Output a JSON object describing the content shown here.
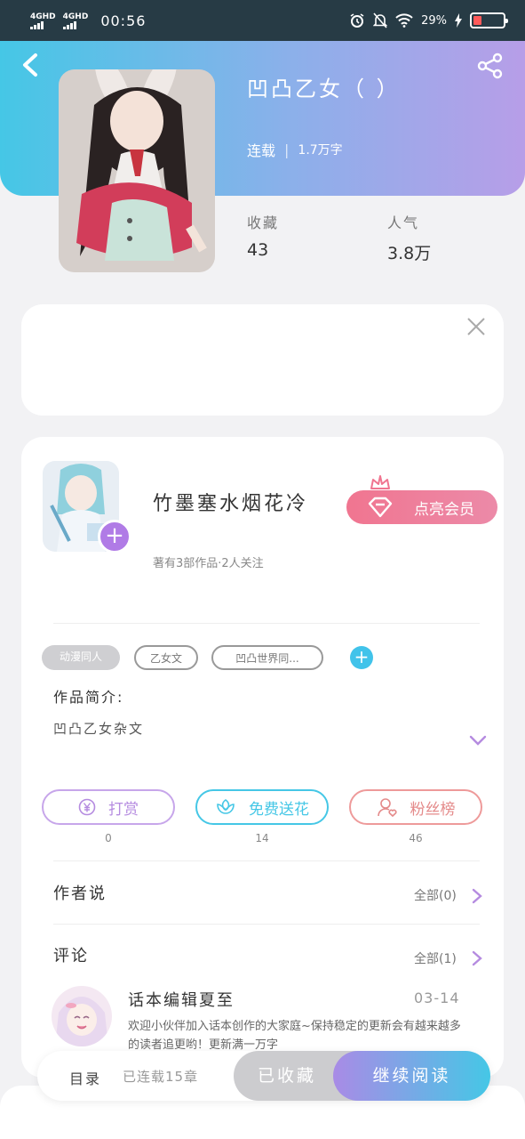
{
  "status_bar": {
    "signal_1": "4GHD",
    "signal_2": "4GHD",
    "time": "00:56",
    "battery_text": "29%",
    "battery_level": 0.29
  },
  "book": {
    "title": "凹凸乙女（ ）",
    "status": "连载",
    "word_count": "1.7万字",
    "favorites_label": "收藏",
    "favorites_value": "43",
    "popularity_label": "人气",
    "popularity_value": "3.8万"
  },
  "author": {
    "name": "竹墨塞水烟花冷",
    "stats": "著有3部作品·2人关注",
    "vip_button": "点亮会员"
  },
  "tags": [
    "动漫同人",
    "乙女文",
    "凹凸世界同..."
  ],
  "intro": {
    "label": "作品简介:",
    "text": "凹凸乙女杂文"
  },
  "actions": [
    {
      "label": "打赏",
      "count": "0",
      "color": "#b58be0"
    },
    {
      "label": "免费送花",
      "count": "14",
      "color": "#45c7e6"
    },
    {
      "label": "粉丝榜",
      "count": "46",
      "color": "#ee8a8a"
    }
  ],
  "author_says": {
    "title": "作者说",
    "all": "全部(0)"
  },
  "comments": {
    "title": "评论",
    "all": "全部(1)",
    "items": [
      {
        "name": "话本编辑夏至",
        "date": "03-14",
        "text": "欢迎小伙伴加入话本创作的大家庭~保持稳定的更新会有越来越多的读者追更哟！更新满一万字"
      }
    ]
  },
  "bottom_bar": {
    "toc": "目录",
    "toc_status": "已连载15章",
    "collected": "已收藏",
    "continue": "继续阅读"
  },
  "colors": {
    "header_start": "#45c7e6",
    "header_end": "#b79ee8",
    "accent_purple": "#b07be6",
    "vip_pink": "#f07590"
  }
}
